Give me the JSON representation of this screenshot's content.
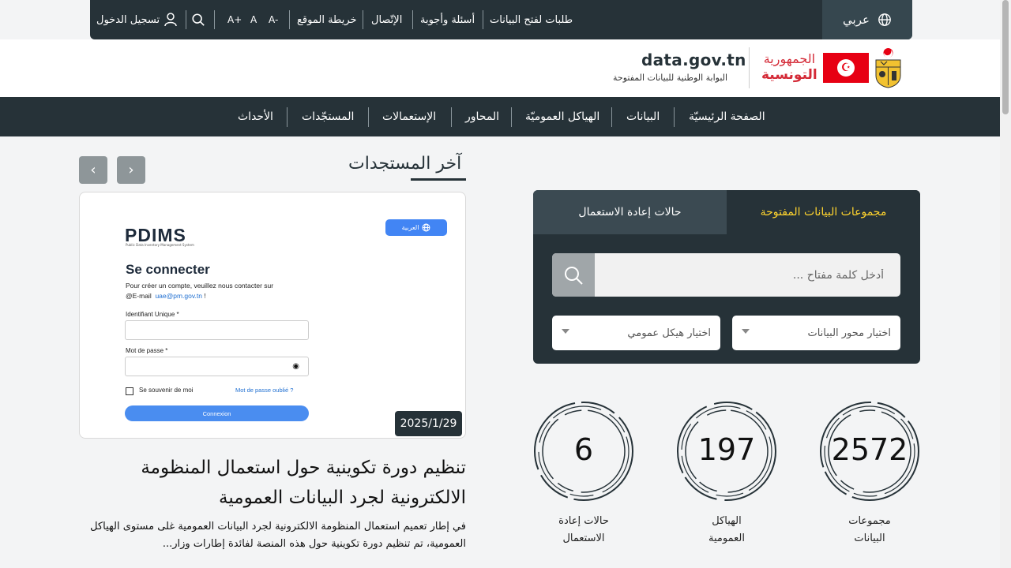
{
  "topbar": {
    "language": "عربي",
    "open_data_requests": "طلبات لفتح البيانات",
    "faq": "أسئلة وأجوبة",
    "contact": "الإتّصال",
    "sitemap": "خريطة الموقع",
    "font_decrease": "A-",
    "font_normal": "A",
    "font_increase": "A+",
    "login": "تسجيل الدخول"
  },
  "header": {
    "site_title": "data.gov.tn",
    "site_subtitle": "البوابة الوطنية للبيانات المفتوحة",
    "republic_line1": "الجمهورية",
    "republic_line2": "التونسية"
  },
  "nav": {
    "home": "الصفحة الرئيسيّة",
    "data": "البيانات",
    "public_structures": "الهياكل العموميّة",
    "themes": "المحاور",
    "reuses": "الإستعمالات",
    "news": "المستجّدات",
    "events": "الأحداث"
  },
  "news": {
    "section_title": "آخر المستجدات",
    "date": "2025/1/29",
    "headline": "تنظيم دورة تكوينية حول استعمال المنظومة الالكترونية لجرد البيانات العمومية",
    "excerpt": "في إطار تعميم استعمال المنظومة الالكترونية لجرد البيانات العمومية غلى مستوى الهياكل العمومية، تم تنظيم دورة تكوينية حول هذه المنصة لفائدة إطارات وزار..."
  },
  "news_image": {
    "logo": "PDIMS",
    "logo_sub": "Public Data Inventory Management System",
    "lang_btn": "العربية",
    "heading": "Se connecter",
    "intro_line1": "Pour créer un compte, veuillez nous contacter sur",
    "intro_line2_prefix": "@E-mail",
    "email": "uae@pm.gov.tn",
    "intro_line2_suffix": "!",
    "identifier_label": "Identifiant Unique *",
    "password_label": "Mot de passe *",
    "remember": "Se souvenir de moi",
    "forgot": "Mot de passe oublié ?",
    "submit": "Connexion"
  },
  "search_panel": {
    "tab_datasets": "مجموعات البيانات المفتوحة",
    "tab_reuses": "حالات إعادة الاستعمال",
    "search_placeholder": "أدخل كلمة مفتاح ...",
    "theme_select": "اختيار محور البيانات",
    "structure_select": "اختيار هيكل عمومي"
  },
  "stats": [
    {
      "value": "2572",
      "label_line1": "مجموعات",
      "label_line2": "البيانات"
    },
    {
      "value": "197",
      "label_line1": "الهياكل",
      "label_line2": "العمومية"
    },
    {
      "value": "6",
      "label_line1": "حالات إعادة",
      "label_line2": "الاستعمال"
    }
  ],
  "colors": {
    "dark": "#263238",
    "active_tab": "#ffd42e",
    "republic_red": "#d42a37",
    "flag_red": "#e70013"
  }
}
